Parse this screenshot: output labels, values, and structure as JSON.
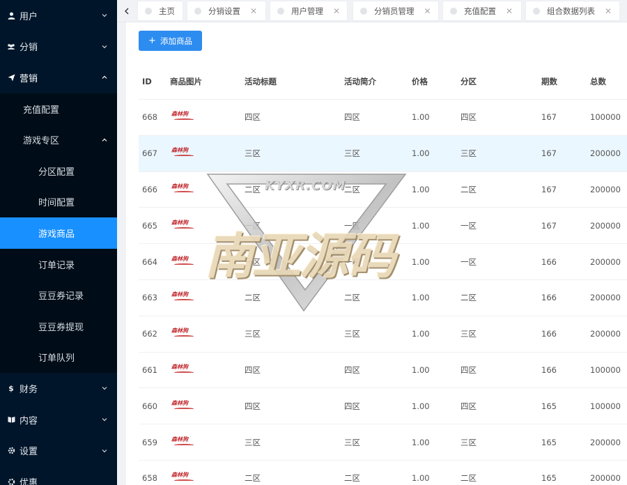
{
  "sidebar": {
    "items": [
      {
        "label": "用户",
        "icon": "user-icon",
        "open": false
      },
      {
        "label": "分销",
        "icon": "group-icon",
        "open": false
      },
      {
        "label": "营销",
        "icon": "send-icon",
        "open": true
      }
    ],
    "marketing_sub": [
      {
        "label": "充值配置"
      },
      {
        "label": "游戏专区"
      }
    ],
    "game_sub": [
      {
        "label": "分区配置"
      },
      {
        "label": "时间配置"
      },
      {
        "label": "游戏商品"
      },
      {
        "label": "订单记录"
      },
      {
        "label": "豆豆券记录"
      },
      {
        "label": "豆豆券提现"
      },
      {
        "label": "订单队列"
      }
    ],
    "bottom_items": [
      {
        "label": "财务",
        "icon": "dollar-icon"
      },
      {
        "label": "内容",
        "icon": "book-icon"
      },
      {
        "label": "设置",
        "icon": "gear-icon"
      },
      {
        "label": "优惠",
        "icon": "gear-icon"
      }
    ]
  },
  "tabs": [
    {
      "label": "主页"
    },
    {
      "label": "分销设置"
    },
    {
      "label": "用户管理"
    },
    {
      "label": "分销员管理"
    },
    {
      "label": "充值配置"
    },
    {
      "label": "组合数据列表"
    }
  ],
  "toolbar": {
    "add_label": "添加商品"
  },
  "table": {
    "headers": {
      "id": "ID",
      "img": "商品图片",
      "title": "活动标题",
      "intro": "活动简介",
      "price": "价格",
      "area": "分区",
      "period": "期数",
      "total": "总数"
    },
    "rows": [
      {
        "id": "668",
        "img": "森林狗",
        "title": "四区",
        "intro": "四区",
        "price": "1.00",
        "area": "四区",
        "period": "167",
        "total": "100000"
      },
      {
        "id": "667",
        "img": "森林狗",
        "title": "三区",
        "intro": "三区",
        "price": "1.00",
        "area": "三区",
        "period": "167",
        "total": "200000"
      },
      {
        "id": "666",
        "img": "森林狗",
        "title": "二区",
        "intro": "二区",
        "price": "1.00",
        "area": "二区",
        "period": "167",
        "total": "200000"
      },
      {
        "id": "665",
        "img": "森林狗",
        "title": "一区",
        "intro": "一区",
        "price": "1.00",
        "area": "一区",
        "period": "167",
        "total": "200000"
      },
      {
        "id": "664",
        "img": "森林狗",
        "title": "一区",
        "intro": "一区",
        "price": "1.00",
        "area": "一区",
        "period": "166",
        "total": "200000"
      },
      {
        "id": "663",
        "img": "森林狗",
        "title": "二区",
        "intro": "二区",
        "price": "1.00",
        "area": "二区",
        "period": "166",
        "total": "200000"
      },
      {
        "id": "662",
        "img": "森林狗",
        "title": "三区",
        "intro": "三区",
        "price": "1.00",
        "area": "三区",
        "period": "166",
        "total": "200000"
      },
      {
        "id": "661",
        "img": "森林狗",
        "title": "四区",
        "intro": "四区",
        "price": "1.00",
        "area": "四区",
        "period": "166",
        "total": "100000"
      },
      {
        "id": "660",
        "img": "森林狗",
        "title": "四区",
        "intro": "四区",
        "price": "1.00",
        "area": "四区",
        "period": "165",
        "total": "100000"
      },
      {
        "id": "659",
        "img": "森林狗",
        "title": "三区",
        "intro": "三区",
        "price": "1.00",
        "area": "三区",
        "period": "165",
        "total": "200000"
      },
      {
        "id": "658",
        "img": "森林狗",
        "title": "二区",
        "intro": "二区",
        "price": "1.00",
        "area": "二区",
        "period": "165",
        "total": "200000"
      }
    ],
    "highlight_row": 1
  },
  "watermark": {
    "text": "南亚源码",
    "sub": "KYXR.COM"
  },
  "colors": {
    "sidebar_bg": "#001529",
    "active": "#1890ff",
    "primary_button": "#2d8cf0",
    "row_highlight": "#ebf7ff"
  }
}
